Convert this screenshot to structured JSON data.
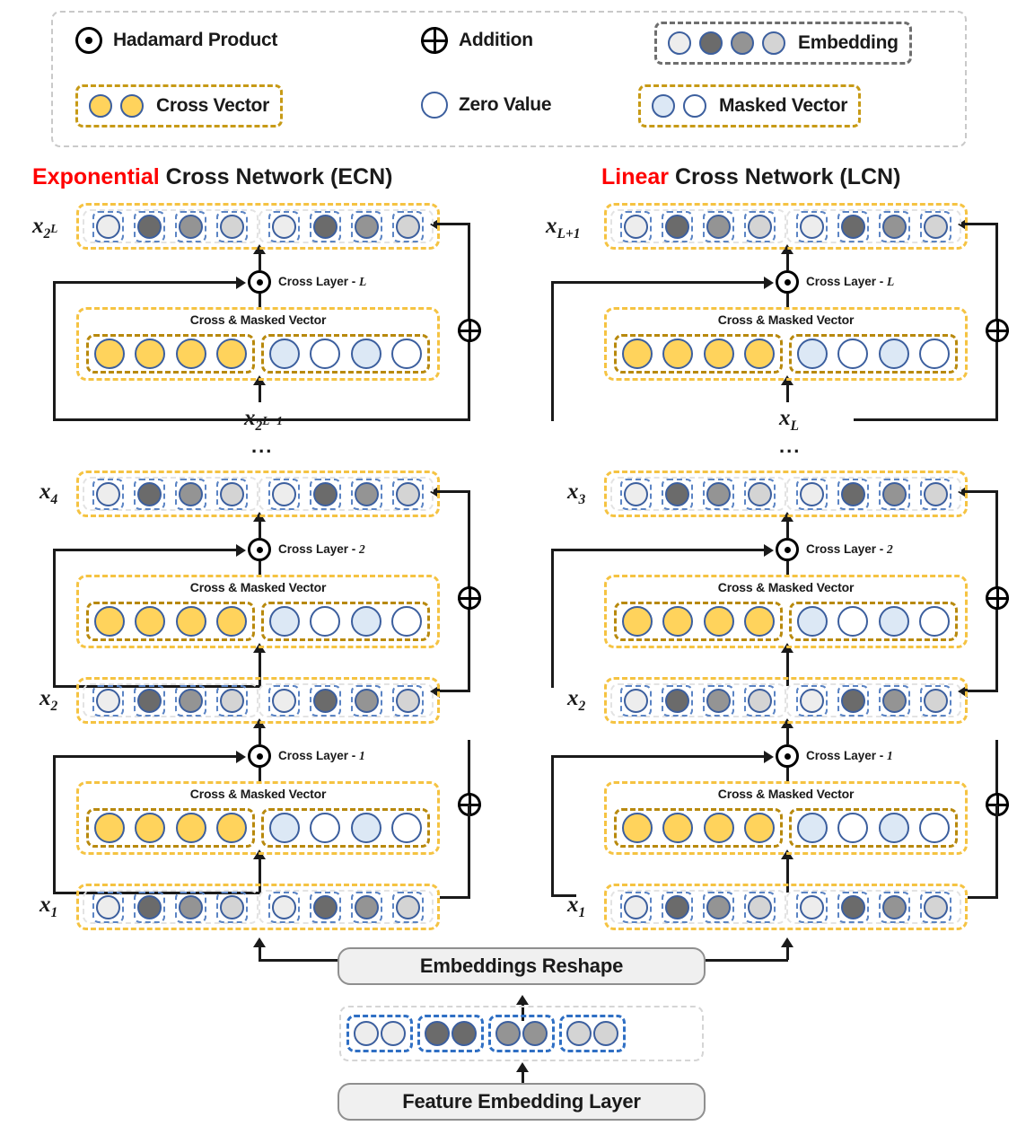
{
  "legend": {
    "items": [
      {
        "key": "hadamard",
        "label": "Hadamard Product",
        "icon": "hadamard-product-icon"
      },
      {
        "key": "addition",
        "label": "Addition",
        "icon": "addition-icon"
      },
      {
        "key": "embedding",
        "label": "Embedding",
        "icon": "embedding-swatch-icon"
      },
      {
        "key": "cross_vector",
        "label": "Cross Vector",
        "icon": "cross-vector-swatch-icon"
      },
      {
        "key": "zero_value",
        "label": "Zero Value",
        "icon": "zero-value-icon"
      },
      {
        "key": "masked_vector",
        "label": "Masked Vector",
        "icon": "masked-vector-swatch-icon"
      }
    ]
  },
  "networks": {
    "ecn": {
      "title_highlight": "Exponential",
      "title_rest": " Cross Network (ECN)",
      "labels": {
        "top": "x",
        "top_sub": "2",
        "top_sup": "L",
        "feedback": "x",
        "feedback_sub": "2",
        "feedback_sup": "L−1",
        "mid": "x",
        "mid_sub": "4",
        "low": "x",
        "low_sub": "2",
        "base": "x",
        "base_sub": "1",
        "ellipsis": "..."
      },
      "cross_layers": [
        {
          "name": "Cross Layer - ",
          "index": "L"
        },
        {
          "name": "Cross Layer - ",
          "index": "2"
        },
        {
          "name": "Cross Layer - ",
          "index": "1"
        }
      ]
    },
    "lcn": {
      "title_highlight": "Linear",
      "title_rest": " Cross Network (LCN)",
      "labels": {
        "top": "x",
        "top_sub": "L+1",
        "feedback": "x",
        "feedback_sub": "L",
        "mid": "x",
        "mid_sub": "3",
        "low": "x",
        "low_sub": "2",
        "base": "x",
        "base_sub": "1",
        "ellipsis": "..."
      },
      "cross_layers": [
        {
          "name": "Cross Layer - ",
          "index": "L"
        },
        {
          "name": "Cross Layer - ",
          "index": "2"
        },
        {
          "name": "Cross Layer - ",
          "index": "1"
        }
      ]
    }
  },
  "blocks": {
    "cross_masked_vector_label": "Cross & Masked Vector",
    "embeddings_reshape": "Embeddings Reshape",
    "feature_embedding_layer": "Feature Embedding Layer"
  },
  "colors": {
    "accent_red": "#ff0000",
    "cross_yellow": "#ffd35c",
    "frame_yellow": "#f5c342",
    "frame_gold": "#b8890d",
    "masked_blue": "#dce8f5",
    "zero_white": "#ffffff",
    "circle_stroke": "#3c5f9e",
    "cell_dash": "#5b84c4",
    "group_blue": "#2f6fc4",
    "box_fill": "#f0f0f0",
    "box_stroke": "#8f8f8f",
    "embedding_shades": [
      "#ededed",
      "#6b6b6b",
      "#949494",
      "#d4d4d4"
    ]
  },
  "embedding_pattern": [
    "#ededed",
    "#6b6b6b",
    "#949494",
    "#d4d4d4"
  ],
  "cross_pattern": [
    "#ffd35c",
    "#ffd35c",
    "#ffd35c",
    "#ffd35c"
  ],
  "masked_pattern": [
    "#dce8f5",
    "#ffffff",
    "#dce8f5",
    "#ffffff"
  ],
  "feature_embedding_pattern": [
    [
      "#ededed",
      "#ededed"
    ],
    [
      "#6b6b6b",
      "#6b6b6b"
    ],
    [
      "#949494",
      "#949494"
    ],
    [
      "#d4d4d4",
      "#d4d4d4"
    ]
  ]
}
